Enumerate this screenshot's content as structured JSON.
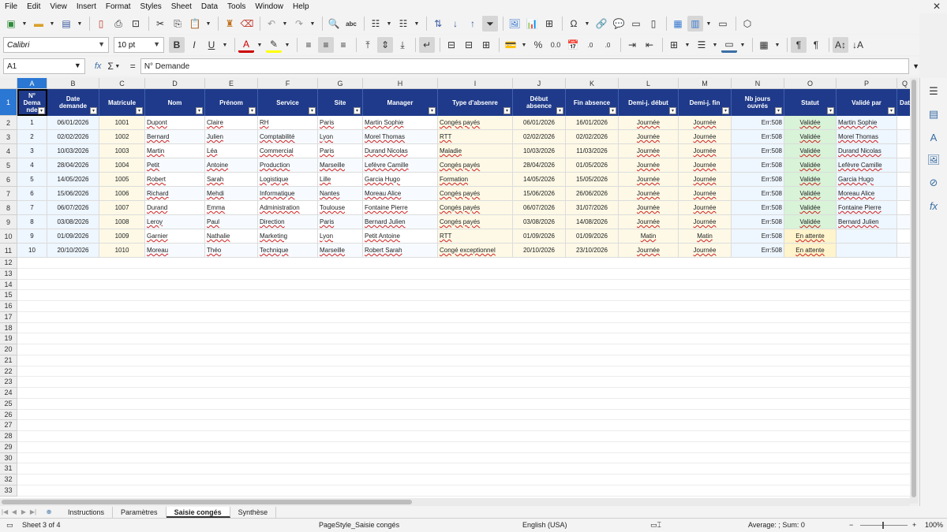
{
  "menu": [
    "File",
    "Edit",
    "View",
    "Insert",
    "Format",
    "Styles",
    "Sheet",
    "Data",
    "Tools",
    "Window",
    "Help"
  ],
  "formatting": {
    "font_name": "Calibri",
    "font_size": "10 pt"
  },
  "formula_bar": {
    "cell_ref": "A1",
    "content": "N° Demande"
  },
  "columns": [
    "A",
    "B",
    "C",
    "D",
    "E",
    "F",
    "G",
    "H",
    "I",
    "J",
    "K",
    "L",
    "M",
    "N",
    "O",
    "P",
    "Q"
  ],
  "headers": [
    "N°\nDema\nnde",
    "Date\ndemande",
    "Matricule",
    "Nom",
    "Prénom",
    "Service",
    "Site",
    "Manager",
    "Type d'absenre",
    "Début\nabsence",
    "Fin absence",
    "Demi-j. début",
    "Demi-j. fin",
    "Nb jours\nouvrés",
    "Statut",
    "Validé par",
    "Dat"
  ],
  "rows": [
    [
      "1",
      "06/01/2026",
      "1001",
      "Dupont",
      "Claire",
      "RH",
      "Paris",
      "Martin Sophie",
      "Congés payés",
      "06/01/2026",
      "16/01/2026",
      "Journée",
      "Journée",
      "Err:508",
      "Validée",
      "Martin Sophie",
      ""
    ],
    [
      "2",
      "02/02/2026",
      "1002",
      "Bernard",
      "Julien",
      "Comptabilité",
      "Lyon",
      "Morel Thomas",
      "RTT",
      "02/02/2026",
      "02/02/2026",
      "Journée",
      "Journée",
      "Err:508",
      "Validée",
      "Morel Thomas",
      ""
    ],
    [
      "3",
      "10/03/2026",
      "1003",
      "Martin",
      "Léa",
      "Commercial",
      "Paris",
      "Durand Nicolas",
      "Maladie",
      "10/03/2026",
      "11/03/2026",
      "Journée",
      "Journée",
      "Err:508",
      "Validée",
      "Durand Nicolas",
      ""
    ],
    [
      "4",
      "28/04/2026",
      "1004",
      "Petit",
      "Antoine",
      "Production",
      "Marseille",
      "Lefèvre Camille",
      "Congés payés",
      "28/04/2026",
      "01/05/2026",
      "Journée",
      "Journée",
      "Err:508",
      "Validée",
      "Lefèvre Camille",
      ""
    ],
    [
      "5",
      "14/05/2026",
      "1005",
      "Robert",
      "Sarah",
      "Logistique",
      "Lille",
      "Garcia Hugo",
      "Formation",
      "14/05/2026",
      "15/05/2026",
      "Journée",
      "Journée",
      "Err:508",
      "Validée",
      "Garcia Hugo",
      ""
    ],
    [
      "6",
      "15/06/2026",
      "1006",
      "Richard",
      "Mehdi",
      "Informatique",
      "Nantes",
      "Moreau Alice",
      "Congés payés",
      "15/06/2026",
      "26/06/2026",
      "Journée",
      "Journée",
      "Err:508",
      "Validée",
      "Moreau Alice",
      ""
    ],
    [
      "7",
      "06/07/2026",
      "1007",
      "Durand",
      "Emma",
      "Administration",
      "Toulouse",
      "Fontaine Pierre",
      "Congés payés",
      "06/07/2026",
      "31/07/2026",
      "Journée",
      "Journée",
      "Err:508",
      "Validée",
      "Fontaine Pierre",
      ""
    ],
    [
      "8",
      "03/08/2026",
      "1008",
      "Leroy",
      "Paul",
      "Direction",
      "Paris",
      "Bernard Julien",
      "Congés payés",
      "03/08/2026",
      "14/08/2026",
      "Journée",
      "Journée",
      "Err:508",
      "Validée",
      "Bernard Julien",
      ""
    ],
    [
      "9",
      "01/09/2026",
      "1009",
      "Garnier",
      "Nathalie",
      "Marketing",
      "Lyon",
      "Petit Antoine",
      "RTT",
      "01/09/2026",
      "01/09/2026",
      "Matin",
      "Matin",
      "Err:508",
      "En attente",
      "",
      ""
    ],
    [
      "10",
      "20/10/2026",
      "1010",
      "Moreau",
      "Théo",
      "Technique",
      "Marseille",
      "Robert Sarah",
      "Congé exceptionnel",
      "20/10/2026",
      "23/10/2026",
      "Journée",
      "Journée",
      "Err:508",
      "En attente",
      "",
      ""
    ]
  ],
  "row_numbers": [
    "1",
    "2",
    "3",
    "4",
    "5",
    "6",
    "7",
    "8",
    "9",
    "10",
    "11",
    "12",
    "13",
    "14",
    "15",
    "16",
    "17",
    "18",
    "19",
    "20",
    "21",
    "22",
    "23",
    "24",
    "25",
    "26",
    "27",
    "28",
    "29",
    "30",
    "31",
    "32",
    "33"
  ],
  "sheet_tabs": [
    "Instructions",
    "Paramètres",
    "Saisie congés",
    "Synthèse"
  ],
  "active_tab": "Saisie congés",
  "status": {
    "sheet": "Sheet 3 of 4",
    "page_style": "PageStyle_Saisie congés",
    "language": "English (USA)",
    "summary": "Average: ; Sum: 0",
    "zoom": "100%"
  },
  "colors": {
    "header_bg": "#1f3a8a",
    "selection": "#2a77d4",
    "validated_bg": "#d8f3d8",
    "pending_bg": "#fff4cc",
    "row_alt_1": "#eef6ff",
    "row_alt_2": "#fdf9e6"
  }
}
